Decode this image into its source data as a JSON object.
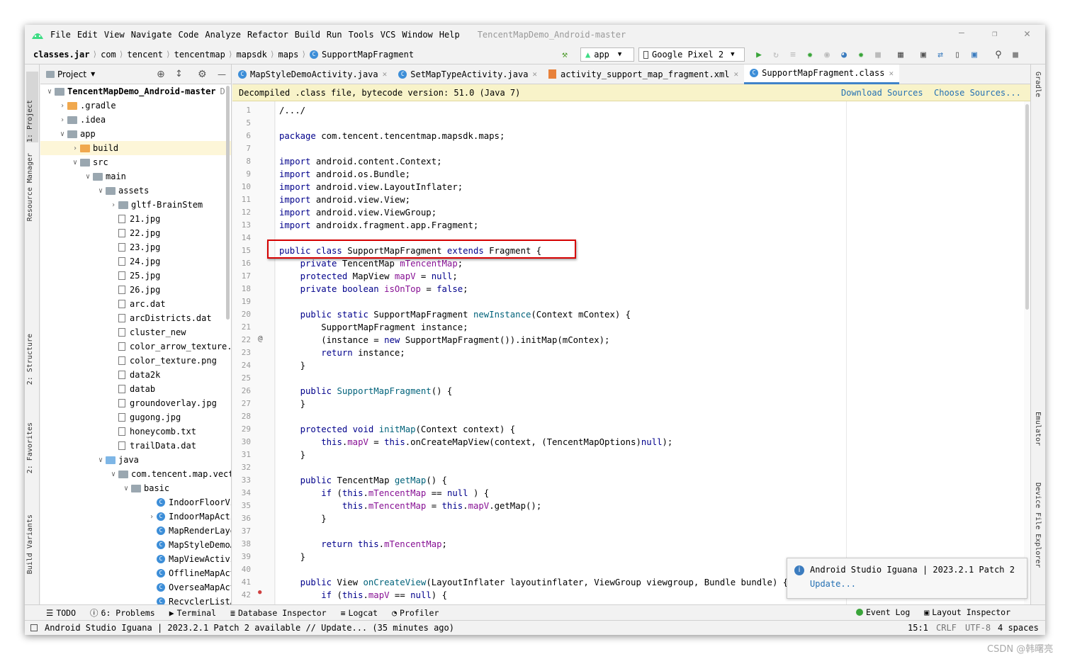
{
  "menu": {
    "items": [
      "File",
      "Edit",
      "View",
      "Navigate",
      "Code",
      "Analyze",
      "Refactor",
      "Build",
      "Run",
      "Tools",
      "VCS",
      "Window",
      "Help"
    ],
    "title": "TencentMapDemo_Android-master"
  },
  "nav": {
    "crumbs": [
      "classes.jar",
      "com",
      "tencent",
      "tencentmap",
      "mapsdk",
      "maps",
      "SupportMapFragment"
    ],
    "run_config": "app",
    "device": "Google Pixel 2"
  },
  "left_stripe": {
    "project": "1: Project",
    "resource": "Resource Manager",
    "structure": "2: Structure",
    "favorites": "2: Favorites",
    "variants": "Build Variants"
  },
  "right_stripe": {
    "gradle": "Gradle",
    "emulator": "Emulator",
    "device_explorer": "Device File Explorer"
  },
  "project": {
    "title": "Project",
    "tree": [
      {
        "label": "TencentMapDemo_Android-master",
        "suffix": "D:",
        "depth": 0,
        "arrow": "v",
        "icon": "folder-gray",
        "bold": true
      },
      {
        "label": ".gradle",
        "depth": 1,
        "arrow": ">",
        "icon": "folder-orange"
      },
      {
        "label": ".idea",
        "depth": 1,
        "arrow": ">",
        "icon": "folder-gray"
      },
      {
        "label": "app",
        "depth": 1,
        "arrow": "v",
        "icon": "folder-gray"
      },
      {
        "label": "build",
        "depth": 2,
        "arrow": ">",
        "icon": "folder-orange"
      },
      {
        "label": "src",
        "depth": 2,
        "arrow": "v",
        "icon": "folder-gray"
      },
      {
        "label": "main",
        "depth": 3,
        "arrow": "v",
        "icon": "folder-gray"
      },
      {
        "label": "assets",
        "depth": 4,
        "arrow": "v",
        "icon": "folder-gray"
      },
      {
        "label": "gltf-BrainStem",
        "depth": 5,
        "arrow": ">",
        "icon": "folder-gray"
      },
      {
        "label": "21.jpg",
        "depth": 5,
        "icon": "file"
      },
      {
        "label": "22.jpg",
        "depth": 5,
        "icon": "file"
      },
      {
        "label": "23.jpg",
        "depth": 5,
        "icon": "file"
      },
      {
        "label": "24.jpg",
        "depth": 5,
        "icon": "file"
      },
      {
        "label": "25.jpg",
        "depth": 5,
        "icon": "file"
      },
      {
        "label": "26.jpg",
        "depth": 5,
        "icon": "file"
      },
      {
        "label": "arc.dat",
        "depth": 5,
        "icon": "file"
      },
      {
        "label": "arcDistricts.dat",
        "depth": 5,
        "icon": "file"
      },
      {
        "label": "cluster_new",
        "depth": 5,
        "icon": "file"
      },
      {
        "label": "color_arrow_texture.",
        "depth": 5,
        "icon": "file"
      },
      {
        "label": "color_texture.png",
        "depth": 5,
        "icon": "file"
      },
      {
        "label": "data2k",
        "depth": 5,
        "icon": "file"
      },
      {
        "label": "datab",
        "depth": 5,
        "icon": "file"
      },
      {
        "label": "groundoverlay.jpg",
        "depth": 5,
        "icon": "file"
      },
      {
        "label": "gugong.jpg",
        "depth": 5,
        "icon": "file"
      },
      {
        "label": "honeycomb.txt",
        "depth": 5,
        "icon": "file"
      },
      {
        "label": "trailData.dat",
        "depth": 5,
        "icon": "file"
      },
      {
        "label": "java",
        "depth": 4,
        "arrow": "v",
        "icon": "folder-blue"
      },
      {
        "label": "com.tencent.map.vect",
        "depth": 5,
        "arrow": "v",
        "icon": "folder-gray"
      },
      {
        "label": "basic",
        "depth": 6,
        "arrow": "v",
        "icon": "folder-gray"
      },
      {
        "label": "IndoorFloorView",
        "depth": 7,
        "icon": "class"
      },
      {
        "label": "IndoorMapActiv",
        "depth": 7,
        "arrow": ">",
        "icon": "class"
      },
      {
        "label": "MapRenderLayerA",
        "depth": 7,
        "icon": "class"
      },
      {
        "label": "MapStyleDemoAct",
        "depth": 7,
        "icon": "class"
      },
      {
        "label": "MapViewActivity",
        "depth": 7,
        "icon": "class"
      },
      {
        "label": "OfflineMapActi",
        "depth": 7,
        "icon": "class"
      },
      {
        "label": "OverseaMapActiv",
        "depth": 7,
        "icon": "class"
      },
      {
        "label": "RecyclerListAct",
        "depth": 7,
        "icon": "class"
      }
    ]
  },
  "tabs": [
    {
      "label": "MapStyleDemoActivity.java",
      "active": false
    },
    {
      "label": "SetMapTypeActivity.java",
      "active": false
    },
    {
      "label": "activity_support_map_fragment.xml",
      "active": false
    },
    {
      "label": "SupportMapFragment.class",
      "active": true
    }
  ],
  "banner": {
    "text": "Decompiled .class file, bytecode version: 51.0 (Java 7)",
    "download": "Download Sources",
    "choose": "Choose Sources..."
  },
  "code": [
    {
      "n": "1",
      "t": [
        [
          "",
          "/.../"
        ]
      ]
    },
    {
      "n": "5",
      "t": []
    },
    {
      "n": "6",
      "t": [
        [
          "kw",
          "package "
        ],
        [
          "",
          "com.tencent.tencentmap.mapsdk.maps;"
        ]
      ]
    },
    {
      "n": "7",
      "t": []
    },
    {
      "n": "8",
      "t": [
        [
          "kw",
          "import "
        ],
        [
          "",
          "android.content.Context;"
        ]
      ]
    },
    {
      "n": "9",
      "t": [
        [
          "kw",
          "import "
        ],
        [
          "",
          "android.os.Bundle;"
        ]
      ]
    },
    {
      "n": "10",
      "t": [
        [
          "kw",
          "import "
        ],
        [
          "",
          "android.view.LayoutInflater;"
        ]
      ]
    },
    {
      "n": "11",
      "t": [
        [
          "kw",
          "import "
        ],
        [
          "",
          "android.view.View;"
        ]
      ]
    },
    {
      "n": "12",
      "t": [
        [
          "kw",
          "import "
        ],
        [
          "",
          "android.view.ViewGroup;"
        ]
      ]
    },
    {
      "n": "13",
      "t": [
        [
          "kw",
          "import "
        ],
        [
          "",
          "androidx.fragment.app.Fragment;"
        ]
      ]
    },
    {
      "n": "14",
      "t": []
    },
    {
      "n": "15",
      "t": [
        [
          "kw",
          "public class "
        ],
        [
          "",
          "SupportMapFragment "
        ],
        [
          "kw",
          "extends "
        ],
        [
          "",
          "Fragment {"
        ]
      ]
    },
    {
      "n": "16",
      "t": [
        [
          "",
          "    "
        ],
        [
          "kw",
          "private "
        ],
        [
          "",
          "TencentMap "
        ],
        [
          "fld",
          "mTencentMap"
        ],
        [
          "",
          ";"
        ]
      ]
    },
    {
      "n": "17",
      "t": [
        [
          "",
          "    "
        ],
        [
          "kw",
          "protected "
        ],
        [
          "",
          "MapView "
        ],
        [
          "fld",
          "mapV"
        ],
        [
          "",
          " = "
        ],
        [
          "kw",
          "null"
        ],
        [
          "",
          ";"
        ]
      ]
    },
    {
      "n": "18",
      "t": [
        [
          "",
          "    "
        ],
        [
          "kw",
          "private boolean "
        ],
        [
          "fld",
          "isOnTop"
        ],
        [
          "",
          " = "
        ],
        [
          "kw",
          "false"
        ],
        [
          "",
          ";"
        ]
      ]
    },
    {
      "n": "19",
      "t": []
    },
    {
      "n": "20",
      "t": [
        [
          "",
          "    "
        ],
        [
          "kw",
          "public static "
        ],
        [
          "",
          "SupportMapFragment "
        ],
        [
          "mth",
          "newInstance"
        ],
        [
          "",
          "(Context mContex) {"
        ]
      ]
    },
    {
      "n": "21",
      "t": [
        [
          "",
          "        SupportMapFragment instance;"
        ]
      ]
    },
    {
      "n": "22",
      "t": [
        [
          "",
          "        (instance = "
        ],
        [
          "kw",
          "new "
        ],
        [
          "",
          "SupportMapFragment()).initMap(mContex);"
        ]
      ]
    },
    {
      "n": "23",
      "t": [
        [
          "",
          "        "
        ],
        [
          "kw",
          "return "
        ],
        [
          "",
          "instance;"
        ]
      ]
    },
    {
      "n": "24",
      "t": [
        [
          "",
          "    }"
        ]
      ]
    },
    {
      "n": "25",
      "t": []
    },
    {
      "n": "26",
      "t": [
        [
          "",
          "    "
        ],
        [
          "kw",
          "public "
        ],
        [
          "mth",
          "SupportMapFragment"
        ],
        [
          "",
          "() {"
        ]
      ]
    },
    {
      "n": "27",
      "t": [
        [
          "",
          "    }"
        ]
      ]
    },
    {
      "n": "28",
      "t": []
    },
    {
      "n": "29",
      "t": [
        [
          "",
          "    "
        ],
        [
          "kw",
          "protected void "
        ],
        [
          "mth",
          "initMap"
        ],
        [
          "",
          "(Context context) {"
        ]
      ]
    },
    {
      "n": "30",
      "t": [
        [
          "",
          "        "
        ],
        [
          "kw",
          "this"
        ],
        [
          "",
          "."
        ],
        [
          "fld",
          "mapV"
        ],
        [
          "",
          " = "
        ],
        [
          "kw",
          "this"
        ],
        [
          "",
          ".onCreateMapView(context, (TencentMapOptions)"
        ],
        [
          "kw",
          "null"
        ],
        [
          "",
          ");"
        ]
      ]
    },
    {
      "n": "31",
      "t": [
        [
          "",
          "    }"
        ]
      ]
    },
    {
      "n": "32",
      "t": []
    },
    {
      "n": "33",
      "t": [
        [
          "",
          "    "
        ],
        [
          "kw",
          "public "
        ],
        [
          "",
          "TencentMap "
        ],
        [
          "mth",
          "getMap"
        ],
        [
          "",
          "() {"
        ]
      ]
    },
    {
      "n": "34",
      "t": [
        [
          "",
          "        "
        ],
        [
          "kw",
          "if "
        ],
        [
          "",
          "("
        ],
        [
          "kw",
          "this"
        ],
        [
          "",
          "."
        ],
        [
          "fld",
          "mTencentMap"
        ],
        [
          "",
          " == "
        ],
        [
          "kw",
          "null"
        ],
        [
          "",
          " ) {"
        ]
      ]
    },
    {
      "n": "35",
      "t": [
        [
          "",
          "            "
        ],
        [
          "kw",
          "this"
        ],
        [
          "",
          "."
        ],
        [
          "fld",
          "mTencentMap"
        ],
        [
          "",
          " = "
        ],
        [
          "kw",
          "this"
        ],
        [
          "",
          "."
        ],
        [
          "fld",
          "mapV"
        ],
        [
          "",
          ".getMap();"
        ]
      ]
    },
    {
      "n": "36",
      "t": [
        [
          "",
          "        }"
        ]
      ]
    },
    {
      "n": "37",
      "t": []
    },
    {
      "n": "38",
      "t": [
        [
          "",
          "        "
        ],
        [
          "kw",
          "return this"
        ],
        [
          "",
          "."
        ],
        [
          "fld",
          "mTencentMap"
        ],
        [
          "",
          ";"
        ]
      ]
    },
    {
      "n": "39",
      "t": [
        [
          "",
          "    }"
        ]
      ]
    },
    {
      "n": "40",
      "t": []
    },
    {
      "n": "41",
      "t": [
        [
          "",
          "    "
        ],
        [
          "kw",
          "public "
        ],
        [
          "",
          "View "
        ],
        [
          "mth",
          "onCreateView"
        ],
        [
          "",
          "(LayoutInflater layoutinflater, ViewGroup viewgroup, Bundle bundle) {"
        ]
      ]
    },
    {
      "n": "42",
      "t": [
        [
          "",
          "        "
        ],
        [
          "kw",
          "if "
        ],
        [
          "",
          "("
        ],
        [
          "kw",
          "this"
        ],
        [
          "",
          "."
        ],
        [
          "fld",
          "mapV"
        ],
        [
          "",
          " == "
        ],
        [
          "kw",
          "null"
        ],
        [
          "",
          ") {"
        ]
      ]
    }
  ],
  "notification": {
    "title": "Android Studio Iguana | 2023.2.1 Patch 2",
    "link": "Update..."
  },
  "bottom_tools": [
    "TODO",
    "6: Problems",
    "Terminal",
    "Database Inspector",
    "Logcat",
    "Profiler"
  ],
  "bottom_right_tools": [
    "Event Log",
    "Layout Inspector"
  ],
  "status": {
    "message": "Android Studio Iguana | 2023.2.1 Patch 2 available // Update... (35 minutes ago)",
    "position": "15:1",
    "line_sep": "CRLF",
    "encoding": "UTF-8",
    "indent": "4 spaces"
  },
  "watermark": "CSDN @韩曙亮",
  "colors": {
    "accent": "#4083c9",
    "highlight_box": "#d50000",
    "banner": "#f8f3c9"
  }
}
